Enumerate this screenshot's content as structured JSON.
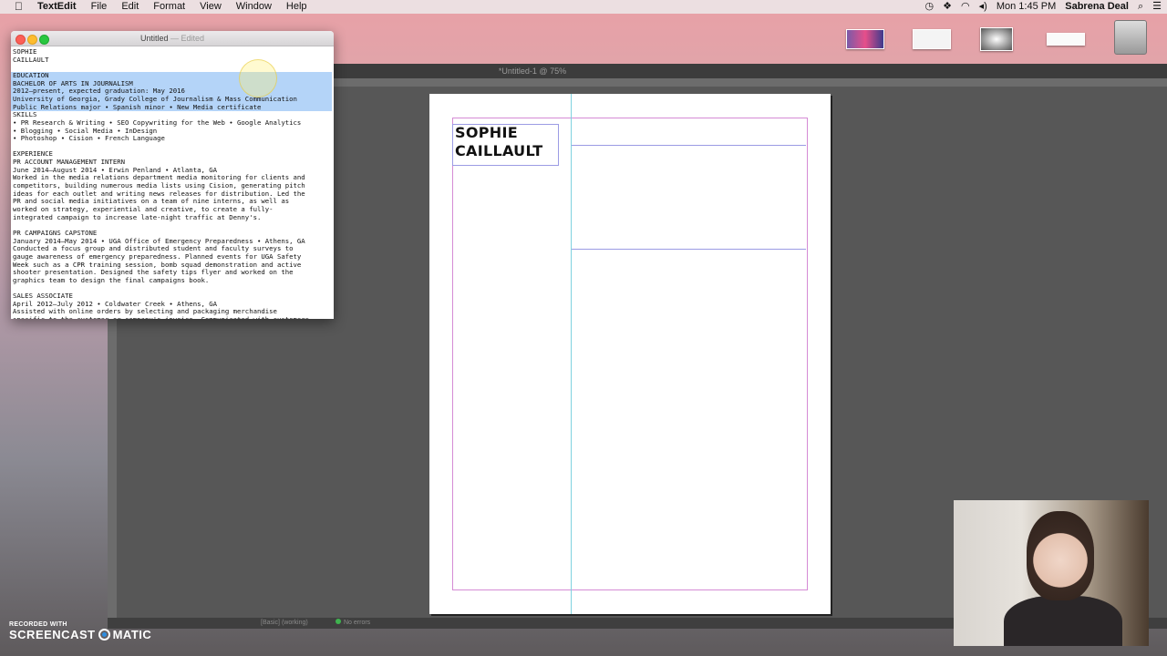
{
  "menubar": {
    "app_name": "TextEdit",
    "items": [
      "File",
      "Edit",
      "Format",
      "View",
      "Window",
      "Help"
    ],
    "clock": "Mon 1:45 PM",
    "user": "Sabrena Deal"
  },
  "textedit": {
    "title": "Untitled",
    "edited": "— Edited",
    "lines": [
      "SOPHIE",
      "CAILLAULT",
      "",
      "EDUCATION",
      "BACHELOR OF ARTS IN JOURNALISM",
      "2012–present, expected graduation: May 2016",
      "University of Georgia, Grady College of Journalism & Mass Communication",
      "Public Relations major • Spanish minor • New Media certificate",
      "SKILLS",
      "• PR Research & Writing • SEO Copywriting for the Web • Google Analytics",
      "• Blogging • Social Media • InDesign",
      "• Photoshop • Cision • French Language",
      "",
      "EXPERIENCE",
      "PR ACCOUNT MANAGEMENT INTERN",
      "June 2014–August 2014 • Erwin Penland • Atlanta, GA",
      "Worked in the media relations department media monitoring for clients and",
      "competitors, building numerous media lists using Cision, generating pitch",
      "ideas for each outlet and writing news releases for distribution. Led the",
      "PR and social media initiatives on a team of nine interns, as well as",
      "worked on strategy, experiential and creative, to create a fully-",
      "integrated campaign to increase late-night traffic at Denny's.",
      "",
      "PR CAMPAIGNS CAPSTONE",
      "January 2014–May 2014 • UGA Office of Emergency Preparedness • Athens, GA",
      "Conducted a focus group and distributed student and faculty surveys to",
      "gauge awareness of emergency preparedness. Planned events for UGA Safety",
      "Week such as a CPR training session, bomb squad demonstration and active",
      "shooter presentation. Designed the safety tips flyer and worked on the",
      "graphics team to design the final campaigns book.",
      "",
      "SALES ASSOCIATE",
      "April 2012–July 2012 • Coldwater Creek • Athens, GA",
      "Assisted with online orders by selecting and packaging merchandise",
      "specific to the customer or company's invoice. Communicated with customers"
    ],
    "selected_lines": [
      3,
      4,
      5,
      6,
      7
    ]
  },
  "indesign": {
    "doc_title": "*Untitled-1 @ 75%",
    "name_line1": "SOPHIE",
    "name_line2": "CAILLAULT",
    "status_working": "[Basic] (working)",
    "status_errors": "No errors"
  },
  "watermark": {
    "recorded_with": "RECORDED WITH",
    "brand_left": "SCREENCAST",
    "brand_right": "MATIC"
  },
  "colors": {
    "selection": "#b4d4f8",
    "margin_guide": "#d58bd5",
    "column_guide": "#7fd2df",
    "frame_edge": "#9b9be4"
  }
}
